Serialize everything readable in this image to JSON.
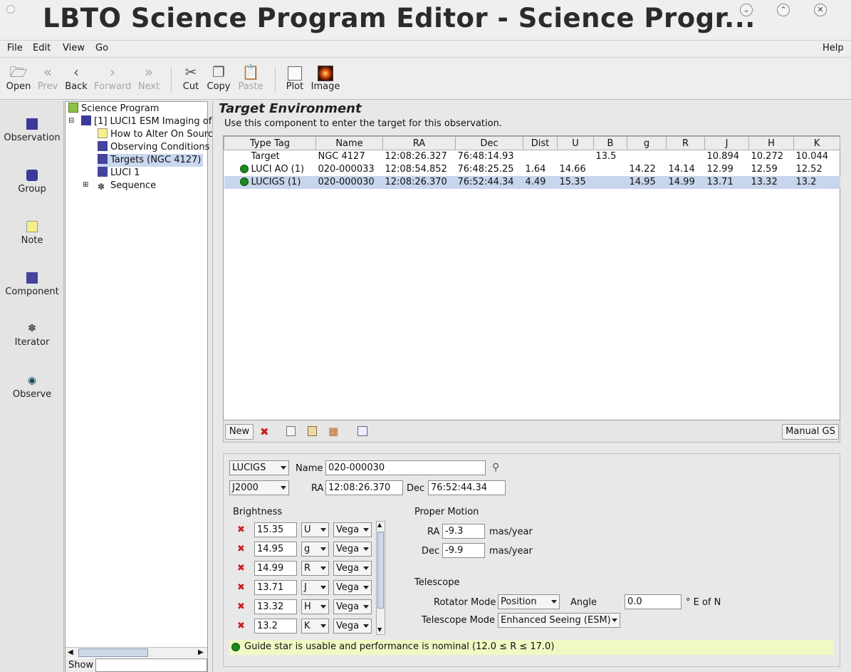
{
  "window": {
    "title": "LBTO Science Program Editor - Science Progr..."
  },
  "menu": {
    "file": "File",
    "edit": "Edit",
    "view": "View",
    "go": "Go",
    "help": "Help"
  },
  "toolbar": {
    "open": "Open",
    "prev": "Prev",
    "back": "Back",
    "forward": "Forward",
    "next": "Next",
    "cut": "Cut",
    "copy": "Copy",
    "paste": "Paste",
    "plot": "Plot",
    "image": "Image"
  },
  "palette": {
    "observation": "Observation",
    "group": "Group",
    "note": "Note",
    "component": "Component",
    "iterator": "Iterator",
    "observe": "Observe"
  },
  "tree": {
    "root": "Science Program",
    "obs": "[1] LUCI1 ESM Imaging of",
    "note": "How to Alter On Sourc",
    "conditions": "Observing Conditions",
    "targets": "Targets (NGC 4127)",
    "luci": "LUCI 1",
    "sequence": "Sequence",
    "show_label": "Show"
  },
  "main": {
    "heading": "Target Environment",
    "description": "Use this component to enter the target for this observation."
  },
  "table": {
    "headers": [
      "Type Tag",
      "Name",
      "RA",
      "Dec",
      "Dist",
      "U",
      "B",
      "g",
      "R",
      "J",
      "H",
      "K"
    ],
    "rows": [
      [
        "Target",
        "NGC 4127",
        "12:08:26.327",
        "76:48:14.93",
        "",
        "",
        "13.5",
        "",
        "",
        "10.894",
        "10.272",
        "10.044"
      ],
      [
        "LUCI AO (1)",
        "020-000033",
        "12:08:54.852",
        "76:48:25.25",
        "1.64",
        "14.66",
        "",
        "14.22",
        "14.14",
        "12.99",
        "12.59",
        "12.52"
      ],
      [
        "LUCIGS (1)",
        "020-000030",
        "12:08:26.370",
        "76:52:44.34",
        "4.49",
        "15.35",
        "",
        "14.95",
        "14.99",
        "13.71",
        "13.32",
        "13.2"
      ]
    ]
  },
  "table_toolbar": {
    "new": "New",
    "manual_gs": "Manual GS"
  },
  "detail": {
    "tag_select": "LUCIGS",
    "name_label": "Name",
    "name_value": "020-000030",
    "coord_system": "J2000",
    "ra_label": "RA",
    "ra_value": "12:08:26.370",
    "dec_label": "Dec",
    "dec_value": "76:52:44.34",
    "brightness_label": "Brightness",
    "brightness": [
      {
        "value": "15.35",
        "band": "U",
        "system": "Vega"
      },
      {
        "value": "14.95",
        "band": "g",
        "system": "Vega"
      },
      {
        "value": "14.99",
        "band": "R",
        "system": "Vega"
      },
      {
        "value": "13.71",
        "band": "J",
        "system": "Vega"
      },
      {
        "value": "13.32",
        "band": "H",
        "system": "Vega"
      },
      {
        "value": "13.2",
        "band": "K",
        "system": "Vega"
      }
    ],
    "proper_motion_label": "Proper Motion",
    "pm_ra_label": "RA",
    "pm_ra_value": "-9.3",
    "pm_dec_label": "Dec",
    "pm_dec_value": "-9.9",
    "pm_unit": "mas/year",
    "telescope_label": "Telescope",
    "rotator_mode_label": "Rotator Mode",
    "rotator_mode_value": "Position",
    "angle_label": "Angle",
    "angle_value": "0.0",
    "angle_unit": "° E of N",
    "telescope_mode_label": "Telescope Mode",
    "telescope_mode_value": "Enhanced Seeing (ESM)",
    "status": "Guide star is usable and performance is nominal (12.0 ≤ R ≤ 17.0)"
  },
  "colors": {
    "selection": "#c7d6ec",
    "status_bg": "#f1f8c4",
    "ok_green": "#1a8a1a",
    "remove_red": "#c82020"
  }
}
